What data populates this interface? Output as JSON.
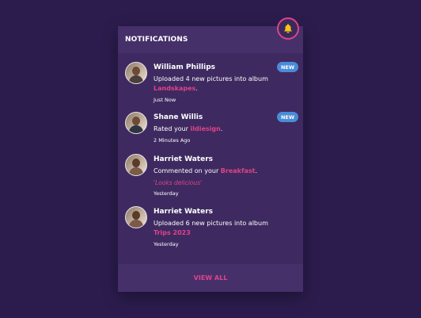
{
  "header": {
    "title": "NOTIFICATIONS",
    "bell_icon": "bell-icon"
  },
  "colors": {
    "accent": "#e0428a",
    "badge": "#4a8bd8",
    "panel": "#3e2a60",
    "background": "#2b1c4d"
  },
  "notifications": [
    {
      "name": "William Phillips",
      "text": "Uploaded 4 new pictures into album",
      "highlight": "Landskapes",
      "suffix": ".",
      "time": "Just Now",
      "badge": "NEW"
    },
    {
      "name": "Shane Willis",
      "text": "Rated your",
      "highlight": "ildiesign",
      "suffix": ".",
      "time": "2 Minutes Ago",
      "badge": "NEW"
    },
    {
      "name": "Harriet Waters",
      "text": "Commented on your",
      "highlight": "Breakfast",
      "suffix": ".",
      "quote": "'Looks delicious'",
      "time": "Yesterday"
    },
    {
      "name": "Harriet Waters",
      "text": "Uploaded 6 new pictures into album",
      "highlight": "Trips 2023",
      "suffix": "",
      "time": "Yesterday"
    }
  ],
  "footer": {
    "view_all": "VIEW ALL"
  }
}
